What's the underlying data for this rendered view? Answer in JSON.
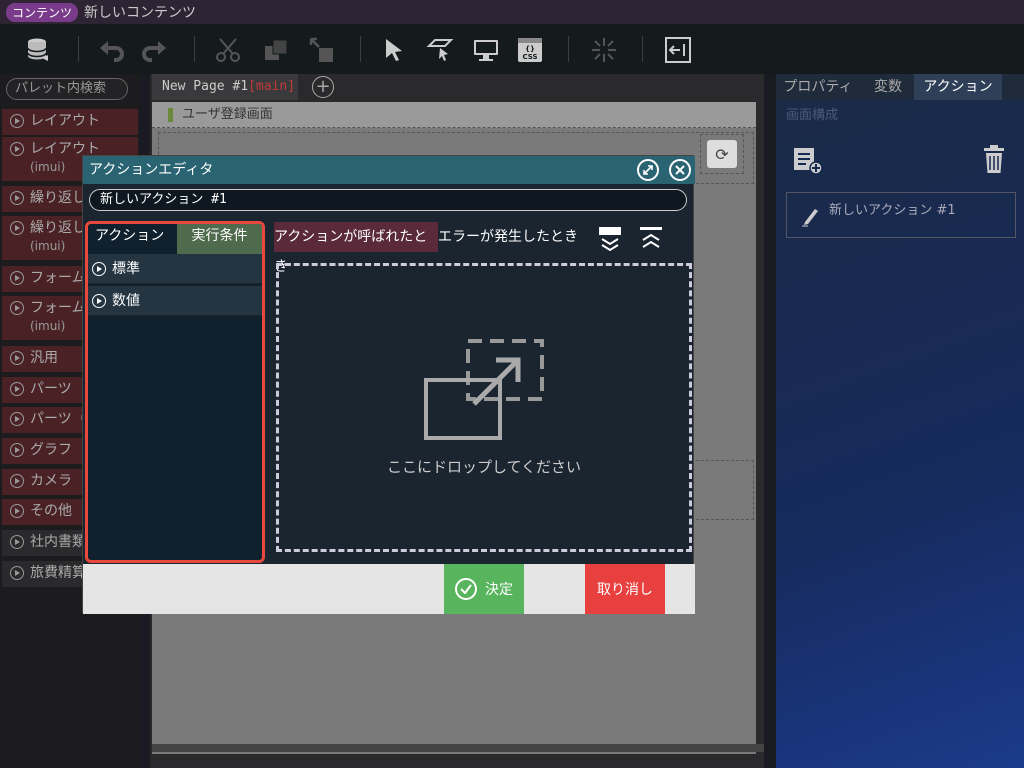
{
  "titlebar": {
    "badge": "コンテンツ",
    "title": "新しいコンテンツ"
  },
  "palette": {
    "search_placeholder": "パレット内検索",
    "items": [
      {
        "label": "レイアウト",
        "sub": ""
      },
      {
        "label": "レイアウト",
        "sub": "(imui)"
      },
      {
        "label": "繰り返し",
        "sub": ""
      },
      {
        "label": "繰り返し",
        "sub": "(imui)"
      },
      {
        "label": "フォーム",
        "sub": ""
      },
      {
        "label": "フォーム",
        "sub": "(imui)"
      },
      {
        "label": "汎用",
        "sub": ""
      },
      {
        "label": "パーツ",
        "sub": ""
      },
      {
        "label": "パーツ（",
        "sub": ""
      },
      {
        "label": "グラフ",
        "sub": ""
      },
      {
        "label": "カメラ",
        "sub": ""
      },
      {
        "label": "その他",
        "sub": ""
      },
      {
        "label": "社内書類",
        "sub": ""
      },
      {
        "label": "旅費精算",
        "sub": ""
      }
    ]
  },
  "center": {
    "page_tab": "New Page #1",
    "page_tab_main": "[main]",
    "add_tab": "+",
    "canvas_header": "ユーザ登録画面"
  },
  "right": {
    "tabs": [
      "プロパティ",
      "変数",
      "アクション"
    ],
    "subtitle": "画面構成",
    "action_item": "新しいアクション #1"
  },
  "modal": {
    "title": "アクションエディタ",
    "action_name": "新しいアクション #1",
    "left_tabs": [
      "アクション",
      "実行条件"
    ],
    "left_items": [
      "標準",
      "数値"
    ],
    "event_tabs": [
      "アクションが呼ばれたとき",
      "エラーが発生したとき"
    ],
    "drop_text": "ここにドロップしてください",
    "ok_label": "決定",
    "cancel_label": "取り消し"
  }
}
